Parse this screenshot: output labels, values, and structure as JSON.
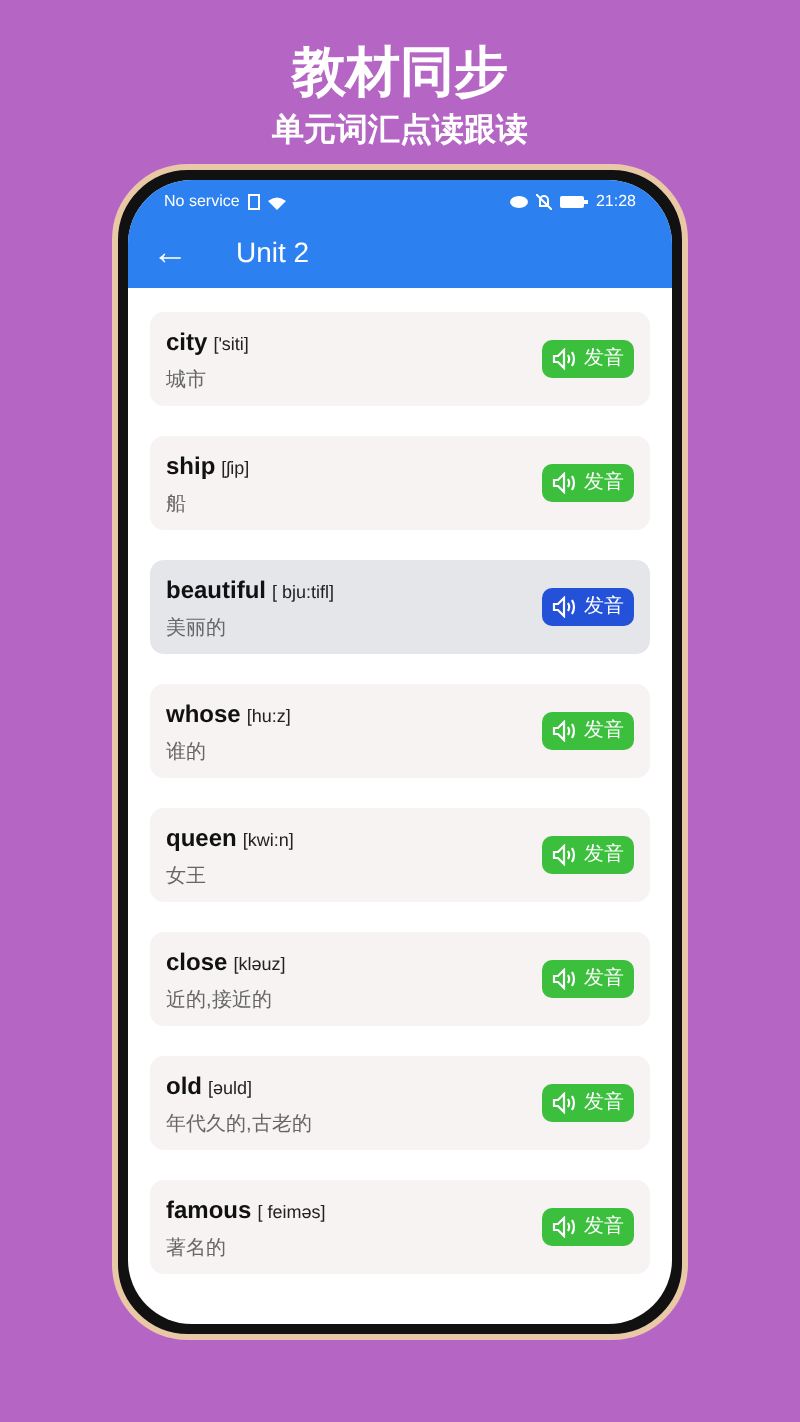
{
  "banner": {
    "title": "教材同步",
    "subtitle": "单元词汇点读跟读"
  },
  "status_bar": {
    "carrier": "No service",
    "time": "21:28"
  },
  "toolbar": {
    "back": "←",
    "title": "Unit 2"
  },
  "words": [
    {
      "word": "city",
      "phonetic": "['siti]",
      "meaning": "城市",
      "button": "发音",
      "selected": false
    },
    {
      "word": "ship",
      "phonetic": "[ʃip]",
      "meaning": "船",
      "button": "发音",
      "selected": false
    },
    {
      "word": "beautiful",
      "phonetic": "[ bju:tifl]",
      "meaning": "美丽的",
      "button": "发音",
      "selected": true
    },
    {
      "word": "whose",
      "phonetic": "[hu:z]",
      "meaning": "谁的",
      "button": "发音",
      "selected": false
    },
    {
      "word": "queen",
      "phonetic": "[kwi:n]",
      "meaning": "女王",
      "button": "发音",
      "selected": false
    },
    {
      "word": "close",
      "phonetic": "[kləuz]",
      "meaning": "近的,接近的",
      "button": "发音",
      "selected": false
    },
    {
      "word": "old",
      "phonetic": "[əuld]",
      "meaning": "年代久的,古老的",
      "button": "发音",
      "selected": false
    },
    {
      "word": "famous",
      "phonetic": "[ feiməs]",
      "meaning": "著名的",
      "button": "发音",
      "selected": false
    }
  ]
}
